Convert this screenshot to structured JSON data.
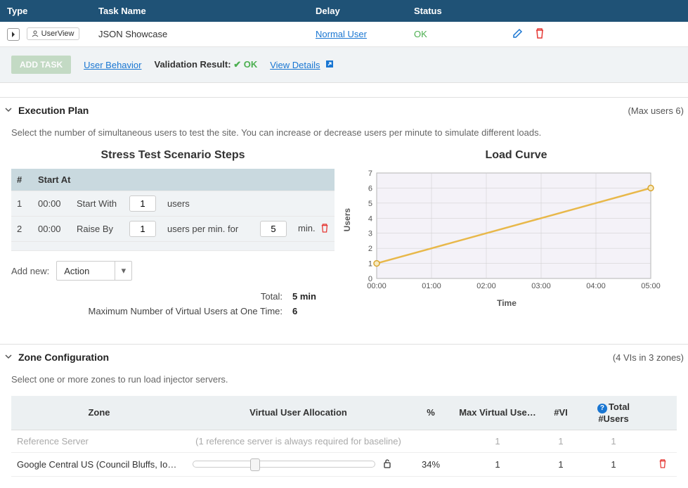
{
  "task_table": {
    "headers": {
      "type": "Type",
      "name": "Task Name",
      "delay": "Delay",
      "status": "Status"
    },
    "row": {
      "userview_badge": "UserView",
      "name": "JSON Showcase",
      "delay": "Normal User",
      "status": "OK"
    }
  },
  "toolbar": {
    "add_task": "ADD TASK",
    "user_behavior": "User Behavior",
    "validation_label": "Validation Result:",
    "ok": "OK",
    "view_details": "View Details"
  },
  "exec_plan": {
    "title": "Execution Plan",
    "meta": "(Max users 6)",
    "desc": "Select the number of simultaneous users to test the site. You can increase or decrease users per minute to simulate different loads.",
    "steps_title": "Stress Test Scenario Steps",
    "headers": {
      "num": "#",
      "start": "Start At"
    },
    "rows": [
      {
        "n": "1",
        "start": "00:00",
        "action": "Start With",
        "v1": "1",
        "suffix": "users"
      },
      {
        "n": "2",
        "start": "00:00",
        "action": "Raise By",
        "v1": "1",
        "mid": "users per min. for",
        "v2": "5",
        "suffix2": "min."
      }
    ],
    "add_new_label": "Add new:",
    "action_select": "Action",
    "totals": {
      "total_label": "Total:",
      "total_value": "5 min",
      "max_label": "Maximum Number of Virtual Users at One Time:",
      "max_value": "6"
    },
    "chart_title": "Load Curve",
    "ylabel": "Users",
    "xlabel": "Time"
  },
  "chart_data": {
    "type": "line",
    "title": "Load Curve",
    "xlabel": "Time",
    "ylabel": "Users",
    "x_ticks": [
      "00:00",
      "01:00",
      "02:00",
      "03:00",
      "04:00",
      "05:00"
    ],
    "y_ticks": [
      0,
      1,
      2,
      3,
      4,
      5,
      6,
      7
    ],
    "ylim": [
      0,
      7
    ],
    "series": [
      {
        "name": "Users",
        "x": [
          "00:00",
          "01:00",
          "02:00",
          "03:00",
          "04:00",
          "05:00"
        ],
        "values": [
          1,
          2,
          3,
          4,
          5,
          6
        ]
      }
    ]
  },
  "zone_config": {
    "title": "Zone Configuration",
    "meta": "(4 VIs in 3 zones)",
    "desc": "Select one or more zones to run load injector servers.",
    "headers": {
      "zone": "Zone",
      "alloc": "Virtual User Allocation",
      "pct": "%",
      "max": "Max Virtual Use…",
      "vi": "#VI",
      "total": "Total #Users"
    },
    "ref_row": {
      "zone": "Reference Server",
      "note": "(1 reference server is always required for baseline)",
      "max": "1",
      "vi": "1",
      "total": "1"
    },
    "rows": [
      {
        "zone": "Google Central US (Council Bluffs, Io…",
        "pct": "34%",
        "max": "1",
        "vi": "1",
        "total": "1",
        "slider_pos": 34
      }
    ]
  }
}
